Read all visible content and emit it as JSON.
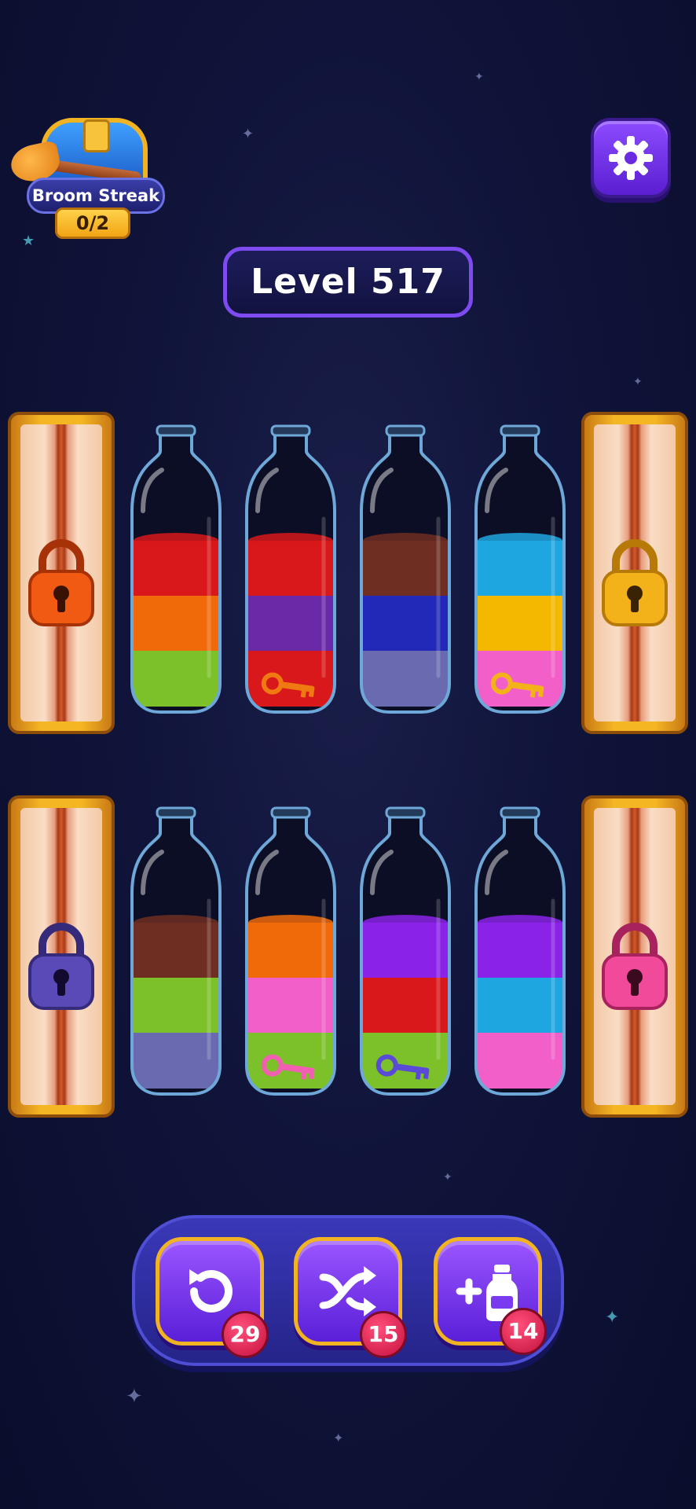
{
  "header": {
    "streak_label": "Broom Streak",
    "streak_count": "0/2",
    "level_label": "Level 517"
  },
  "colors": {
    "red": "#d8181a",
    "orange": "#f06a0a",
    "green": "#7cc12a",
    "purple": "#6a2aa8",
    "brown": "#6e2e22",
    "dark_blue": "#2228b8",
    "lavender": "#6a6ab0",
    "cyan": "#1ea6e0",
    "yellow": "#f4b800",
    "pink": "#f25fc8",
    "violet": "#8a22e8"
  },
  "bottles": [
    {
      "row": 1,
      "layers_top_to_bottom": [
        "red",
        "orange",
        "green"
      ],
      "key": null
    },
    {
      "row": 1,
      "layers_top_to_bottom": [
        "red",
        "purple",
        "red"
      ],
      "key": "orange-key"
    },
    {
      "row": 1,
      "layers_top_to_bottom": [
        "brown",
        "dark_blue",
        "lavender"
      ],
      "key": null
    },
    {
      "row": 1,
      "layers_top_to_bottom": [
        "cyan",
        "yellow",
        "pink"
      ],
      "key": "gold-key"
    },
    {
      "row": 2,
      "layers_top_to_bottom": [
        "brown",
        "green",
        "lavender"
      ],
      "key": null
    },
    {
      "row": 2,
      "layers_top_to_bottom": [
        "orange",
        "pink",
        "green"
      ],
      "key": "pink-key"
    },
    {
      "row": 2,
      "layers_top_to_bottom": [
        "violet",
        "red",
        "green"
      ],
      "key": "purple-key"
    },
    {
      "row": 2,
      "layers_top_to_bottom": [
        "violet",
        "cyan",
        "pink"
      ],
      "key": null
    }
  ],
  "locks": [
    {
      "position": "top-left",
      "lock_color": "#f05a12"
    },
    {
      "position": "top-right",
      "lock_color": "#f4b21a"
    },
    {
      "position": "bottom-left",
      "lock_color": "#5a4ab8"
    },
    {
      "position": "bottom-right",
      "lock_color": "#f24a9a"
    }
  ],
  "actions": {
    "undo": {
      "icon": "undo-icon",
      "count": "29"
    },
    "shuffle": {
      "icon": "shuffle-icon",
      "count": "15"
    },
    "add_bottle": {
      "icon": "add-bottle-icon",
      "count": "14"
    }
  }
}
